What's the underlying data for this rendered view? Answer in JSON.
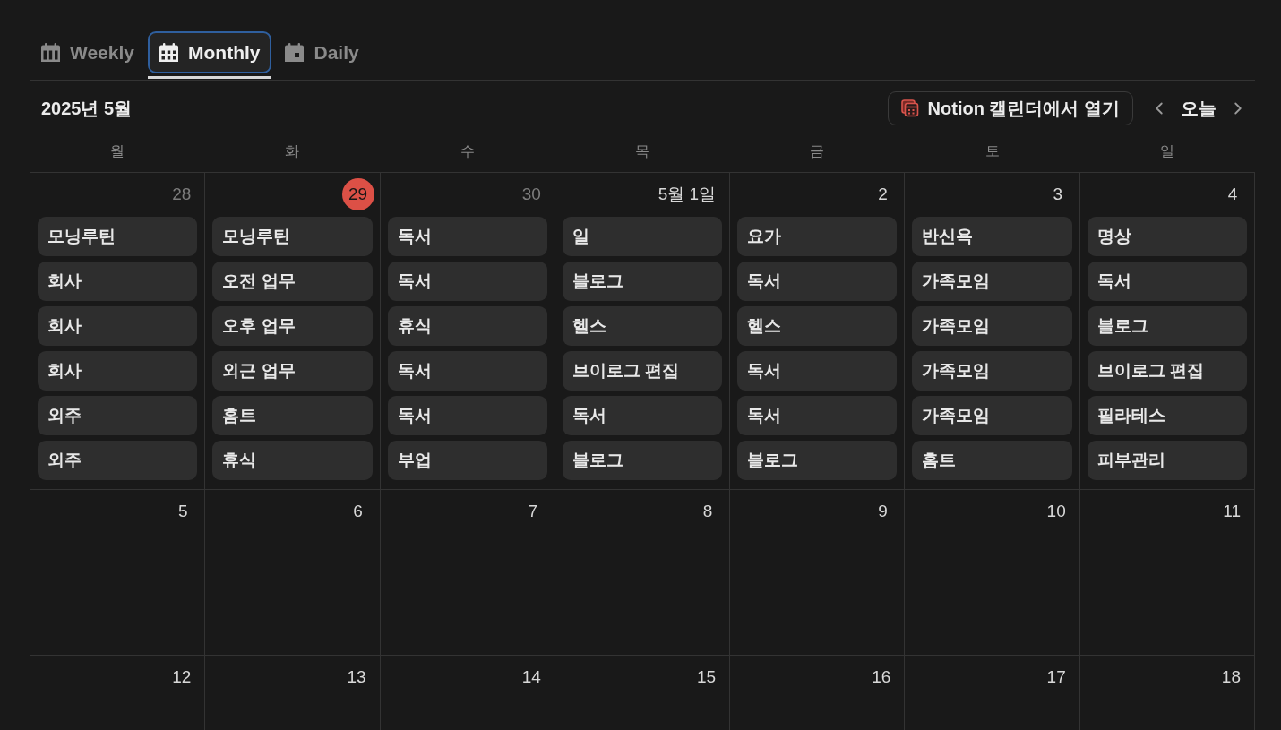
{
  "view_tabs": [
    {
      "label": "Weekly",
      "kind": "week",
      "selected": false
    },
    {
      "label": "Monthly",
      "kind": "month",
      "selected": true
    },
    {
      "label": "Daily",
      "kind": "day",
      "selected": false
    }
  ],
  "header": {
    "title": "2025년 5월",
    "open_button": "Notion 캘린더에서 열기",
    "today_button": "오늘"
  },
  "weekdays": [
    "월",
    "화",
    "수",
    "목",
    "금",
    "토",
    "일"
  ],
  "weeks": [
    {
      "days": [
        {
          "date": "28",
          "other_month": true,
          "today": false,
          "events": [
            "모닝루틴",
            "회사",
            "회사",
            "회사",
            "외주",
            "외주"
          ]
        },
        {
          "date": "29",
          "other_month": false,
          "today": true,
          "events": [
            "모닝루틴",
            "오전 업무",
            "오후 업무",
            "외근 업무",
            "홈트",
            "휴식"
          ]
        },
        {
          "date": "30",
          "other_month": true,
          "today": false,
          "events": [
            "독서",
            "독서",
            "휴식",
            "독서",
            "독서",
            "부업"
          ]
        },
        {
          "date": "5월 1일",
          "other_month": false,
          "today": false,
          "events": [
            "일",
            "블로그",
            "헬스",
            "브이로그 편집",
            "독서",
            "블로그"
          ]
        },
        {
          "date": "2",
          "other_month": false,
          "today": false,
          "events": [
            "요가",
            "독서",
            "헬스",
            "독서",
            "독서",
            "블로그"
          ]
        },
        {
          "date": "3",
          "other_month": false,
          "today": false,
          "events": [
            "반신욕",
            "가족모임",
            "가족모임",
            "가족모임",
            "가족모임",
            "홈트"
          ]
        },
        {
          "date": "4",
          "other_month": false,
          "today": false,
          "events": [
            "명상",
            "독서",
            "블로그",
            "브이로그 편집",
            "필라테스",
            "피부관리"
          ]
        }
      ]
    },
    {
      "days": [
        {
          "date": "5",
          "other_month": false,
          "today": false
        },
        {
          "date": "6",
          "other_month": false,
          "today": false
        },
        {
          "date": "7",
          "other_month": false,
          "today": false
        },
        {
          "date": "8",
          "other_month": false,
          "today": false
        },
        {
          "date": "9",
          "other_month": false,
          "today": false
        },
        {
          "date": "10",
          "other_month": false,
          "today": false
        },
        {
          "date": "11",
          "other_month": false,
          "today": false
        }
      ]
    },
    {
      "days": [
        {
          "date": "12",
          "other_month": false,
          "today": false
        },
        {
          "date": "13",
          "other_month": false,
          "today": false
        },
        {
          "date": "14",
          "other_month": false,
          "today": false
        },
        {
          "date": "15",
          "other_month": false,
          "today": false
        },
        {
          "date": "16",
          "other_month": false,
          "today": false
        },
        {
          "date": "17",
          "other_month": false,
          "today": false
        },
        {
          "date": "18",
          "other_month": false,
          "today": false
        }
      ]
    }
  ]
}
